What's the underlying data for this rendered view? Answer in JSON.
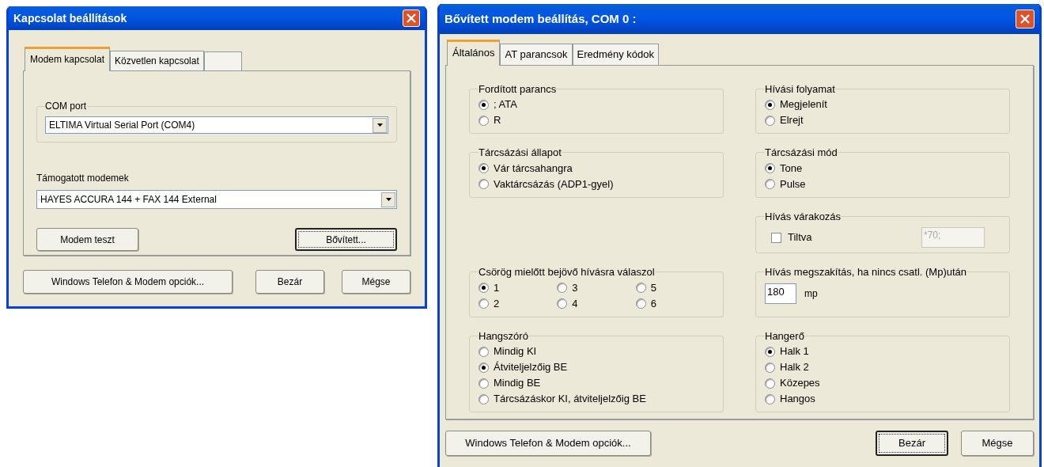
{
  "connection_dialog": {
    "title": "Kapcsolat beállítások",
    "tabs": [
      {
        "label": "Modem kapcsolat",
        "selected": true
      },
      {
        "label": "Közvetlen kapcsolat",
        "selected": false
      },
      {
        "selected": false
      }
    ],
    "com_port": {
      "label": "COM port",
      "value": "ELTIMA Virtual Serial Port (COM4)"
    },
    "modems": {
      "label": "Támogatott modemek",
      "value": "HAYES ACCURA 144 + FAX 144 External"
    },
    "panel_buttons": [
      {
        "label": "Modem teszt",
        "focused": false
      },
      {
        "label": "Bővített...",
        "focused": true
      }
    ],
    "footer_buttons": [
      {
        "label": "Windows Telefon & Modem opciók...",
        "focused": false
      },
      {
        "label": "Bezár",
        "focused": false
      },
      {
        "label": "Mégse",
        "focused": false
      }
    ]
  },
  "advanced_dialog": {
    "title": "Bővített modem beállítás, COM 0 :",
    "tabs": [
      {
        "label": "Általános",
        "selected": true
      },
      {
        "label": "AT parancsok",
        "selected": false
      },
      {
        "label": "Eredmény kódok",
        "selected": false
      }
    ],
    "rows": [
      {
        "left": {
          "kind": "radio",
          "title": "Fordított parancs",
          "options": [
            {
              "label": "; ATA",
              "selected": true
            },
            {
              "label": "R",
              "selected": false
            }
          ]
        },
        "right": {
          "kind": "radio",
          "title": "Hívási folyamat",
          "options": [
            {
              "label": "Megjelenít",
              "selected": true
            },
            {
              "label": "Elrejt",
              "selected": false
            }
          ]
        }
      },
      {
        "left": {
          "kind": "radio",
          "title": "Tárcsázási állapot",
          "options": [
            {
              "label": "Vár tárcsahangra",
              "selected": true
            },
            {
              "label": "Vaktárcsázás (ADP1-gyel)",
              "selected": false
            }
          ]
        },
        "right": {
          "kind": "radio",
          "title": "Tárcsázási mód",
          "options": [
            {
              "label": "Tone",
              "selected": true
            },
            {
              "label": "Pulse",
              "selected": false
            }
          ]
        }
      },
      {
        "right": {
          "kind": "checkbox_field",
          "title": "Hívás várakozás",
          "checkbox": {
            "label": "Tiltva",
            "checked": false
          },
          "field": {
            "value": "*70;",
            "disabled": true
          }
        }
      },
      {
        "left": {
          "kind": "radio_grid",
          "title": "Csörög mielőtt bejövő hívásra válaszol",
          "options": [
            {
              "label": "1",
              "selected": true
            },
            {
              "label": "2",
              "selected": false
            },
            {
              "label": "3",
              "selected": false
            },
            {
              "label": "4",
              "selected": false
            },
            {
              "label": "5",
              "selected": false
            },
            {
              "label": "6",
              "selected": false
            }
          ]
        },
        "right": {
          "kind": "number_field",
          "title": "Hívás megszakítás, ha nincs csatl. (Mp)után",
          "field": {
            "value": "180"
          },
          "unit": "mp"
        }
      },
      {
        "left": {
          "kind": "radio",
          "title": "Hangszóró",
          "options": [
            {
              "label": "Mindig KI",
              "selected": false
            },
            {
              "label": "Átviteljelzőig BE",
              "selected": true
            },
            {
              "label": "Mindig BE",
              "selected": false
            },
            {
              "label": "Tárcsázáskor KI, átviteljelzőig BE",
              "selected": false
            }
          ]
        },
        "right": {
          "kind": "radio",
          "title": "Hangerő",
          "options": [
            {
              "label": "Halk 1",
              "selected": true
            },
            {
              "label": "Halk 2",
              "selected": false
            },
            {
              "label": "Közepes",
              "selected": false
            },
            {
              "label": "Hangos",
              "selected": false
            }
          ]
        }
      }
    ],
    "footer_buttons": [
      {
        "label": "Windows Telefon & Modem opciók...",
        "focused": false
      },
      {
        "label": "Bezár",
        "focused": true
      },
      {
        "label": "Mégse",
        "focused": false
      }
    ]
  }
}
